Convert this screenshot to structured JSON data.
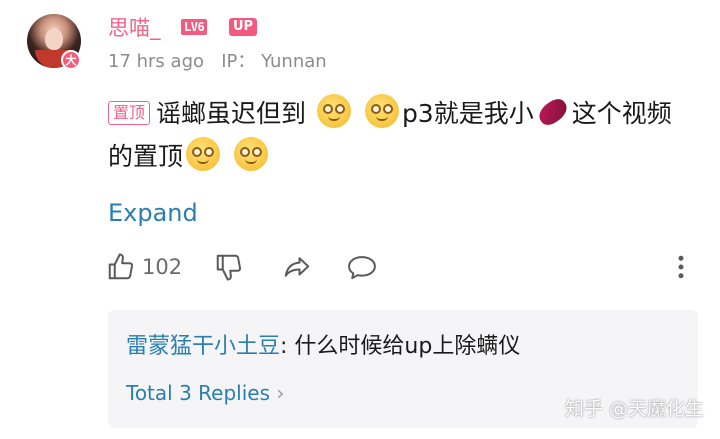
{
  "comment": {
    "username": "思喵_",
    "level_badge": "LV6",
    "up_badge": "UP",
    "avatar_badge": "大",
    "timestamp": "17 hrs ago",
    "ip_label": "IP：",
    "ip_location": "Yunnan",
    "pin_tag": "置顶",
    "text_part1": "谣螂虽迟但到",
    "text_part2": "p3就是我小",
    "text_part3": "这个视频的置顶",
    "emoji": "dizzy-face-emoji",
    "sweet_potato": "sweet-potato-emoji",
    "expand_label": "Expand",
    "like_count": "102"
  },
  "actions": {
    "like_icon": "thumbs-up-icon",
    "dislike_icon": "thumbs-down-icon",
    "share_icon": "share-icon",
    "reply_icon": "comment-icon",
    "more_icon": "more-vertical-icon"
  },
  "replies": {
    "author": "雷蒙猛干小土豆",
    "separator": ": ",
    "text": "什么时候给up上除螨仪",
    "total_label": "Total 3 Replies",
    "chevron": "›"
  },
  "watermark": "知乎 @天魔化生",
  "colors": {
    "username_pink": "#f0648a",
    "link_blue": "#2a7fb0",
    "meta_gray": "#8c8c8c",
    "reply_bg": "#f5f5f7"
  }
}
